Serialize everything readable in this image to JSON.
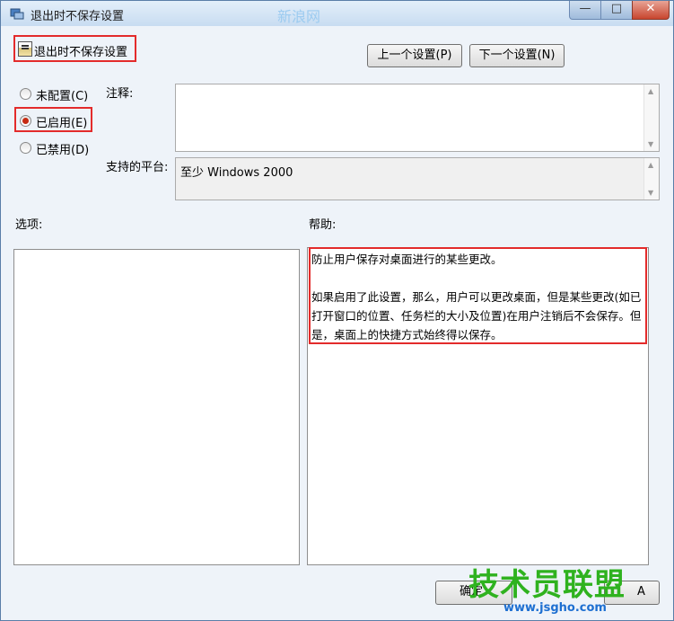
{
  "window": {
    "title": "退出时不保存设置",
    "minimize_glyph": "—",
    "maximize_glyph": "□",
    "close_glyph": "✕"
  },
  "header": {
    "policy_name": "退出时不保存设置",
    "prev_button": "上一个设置(P)",
    "next_button": "下一个设置(N)"
  },
  "state": {
    "options": [
      {
        "label": "未配置(C)",
        "checked": false
      },
      {
        "label": "已启用(E)",
        "checked": true
      },
      {
        "label": "已禁用(D)",
        "checked": false
      }
    ]
  },
  "comment": {
    "label": "注释:",
    "value": ""
  },
  "platform": {
    "label": "支持的平台:",
    "value": "至少 Windows 2000"
  },
  "sections": {
    "options_label": "选项:",
    "help_label": "帮助:"
  },
  "help": {
    "line1": "防止用户保存对桌面进行的某些更改。",
    "line2": "如果启用了此设置，那么，用户可以更改桌面，但是某些更改(如已打开窗口的位置、任务栏的大小及位置)在用户注销后不会保存。但是，桌面上的快捷方式始终得以保存。"
  },
  "footer": {
    "ok_button": "确定",
    "apply_button_partial": "A"
  },
  "watermark": {
    "top_text": "新浪网",
    "brand": "技术员联盟",
    "url": "www.jsgho.com"
  },
  "colors": {
    "highlight_border": "#e32b2b",
    "radio_dot": "#c62b13"
  }
}
